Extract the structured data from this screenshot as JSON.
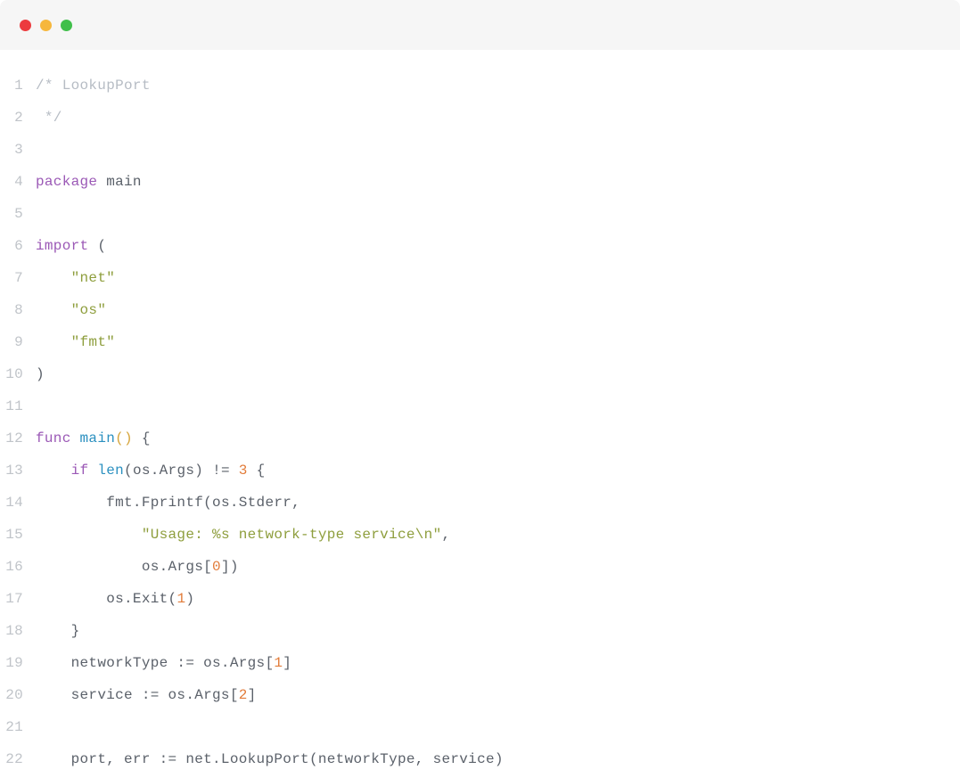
{
  "titlebar": {
    "lights": [
      "red",
      "yellow",
      "green"
    ]
  },
  "gutter_start": 1,
  "code_lines": [
    [
      {
        "t": "comment",
        "v": "/* LookupPort"
      }
    ],
    [
      {
        "t": "comment",
        "v": " */"
      }
    ],
    [],
    [
      {
        "t": "keyword",
        "v": "package"
      },
      {
        "t": "plain",
        "v": " "
      },
      {
        "t": "ident",
        "v": "main"
      }
    ],
    [],
    [
      {
        "t": "keyword",
        "v": "import"
      },
      {
        "t": "plain",
        "v": " "
      },
      {
        "t": "paren",
        "v": "("
      }
    ],
    [
      {
        "t": "plain",
        "v": "    "
      },
      {
        "t": "string",
        "v": "\"net\""
      }
    ],
    [
      {
        "t": "plain",
        "v": "    "
      },
      {
        "t": "string",
        "v": "\"os\""
      }
    ],
    [
      {
        "t": "plain",
        "v": "    "
      },
      {
        "t": "string",
        "v": "\"fmt\""
      }
    ],
    [
      {
        "t": "paren",
        "v": ")"
      }
    ],
    [],
    [
      {
        "t": "keyword",
        "v": "func"
      },
      {
        "t": "plain",
        "v": " "
      },
      {
        "t": "func",
        "v": "main"
      },
      {
        "t": "paren-yellow",
        "v": "()"
      },
      {
        "t": "plain",
        "v": " "
      },
      {
        "t": "punct",
        "v": "{"
      }
    ],
    [
      {
        "t": "plain",
        "v": "    "
      },
      {
        "t": "keyword",
        "v": "if"
      },
      {
        "t": "plain",
        "v": " "
      },
      {
        "t": "builtin",
        "v": "len"
      },
      {
        "t": "paren",
        "v": "("
      },
      {
        "t": "ident",
        "v": "os.Args"
      },
      {
        "t": "paren",
        "v": ")"
      },
      {
        "t": "plain",
        "v": " != "
      },
      {
        "t": "number",
        "v": "3"
      },
      {
        "t": "plain",
        "v": " "
      },
      {
        "t": "punct",
        "v": "{"
      }
    ],
    [
      {
        "t": "plain",
        "v": "        "
      },
      {
        "t": "ident",
        "v": "fmt.Fprintf"
      },
      {
        "t": "paren",
        "v": "("
      },
      {
        "t": "ident",
        "v": "os.Stderr"
      },
      {
        "t": "punct",
        "v": ","
      }
    ],
    [
      {
        "t": "plain",
        "v": "            "
      },
      {
        "t": "string",
        "v": "\"Usage: %s network-type service\\n\""
      },
      {
        "t": "punct",
        "v": ","
      }
    ],
    [
      {
        "t": "plain",
        "v": "            "
      },
      {
        "t": "ident",
        "v": "os.Args"
      },
      {
        "t": "punct",
        "v": "["
      },
      {
        "t": "number",
        "v": "0"
      },
      {
        "t": "punct",
        "v": "]"
      },
      {
        "t": "paren",
        "v": ")"
      }
    ],
    [
      {
        "t": "plain",
        "v": "        "
      },
      {
        "t": "ident",
        "v": "os.Exit"
      },
      {
        "t": "paren",
        "v": "("
      },
      {
        "t": "number",
        "v": "1"
      },
      {
        "t": "paren",
        "v": ")"
      }
    ],
    [
      {
        "t": "plain",
        "v": "    "
      },
      {
        "t": "punct",
        "v": "}"
      }
    ],
    [
      {
        "t": "plain",
        "v": "    "
      },
      {
        "t": "ident",
        "v": "networkType := os.Args"
      },
      {
        "t": "punct",
        "v": "["
      },
      {
        "t": "number",
        "v": "1"
      },
      {
        "t": "punct",
        "v": "]"
      }
    ],
    [
      {
        "t": "plain",
        "v": "    "
      },
      {
        "t": "ident",
        "v": "service := os.Args"
      },
      {
        "t": "punct",
        "v": "["
      },
      {
        "t": "number",
        "v": "2"
      },
      {
        "t": "punct",
        "v": "]"
      }
    ],
    [],
    [
      {
        "t": "plain",
        "v": "    "
      },
      {
        "t": "ident",
        "v": "port, err := net.LookupPort"
      },
      {
        "t": "paren",
        "v": "("
      },
      {
        "t": "ident",
        "v": "networkType, service"
      },
      {
        "t": "paren",
        "v": ")"
      }
    ]
  ]
}
